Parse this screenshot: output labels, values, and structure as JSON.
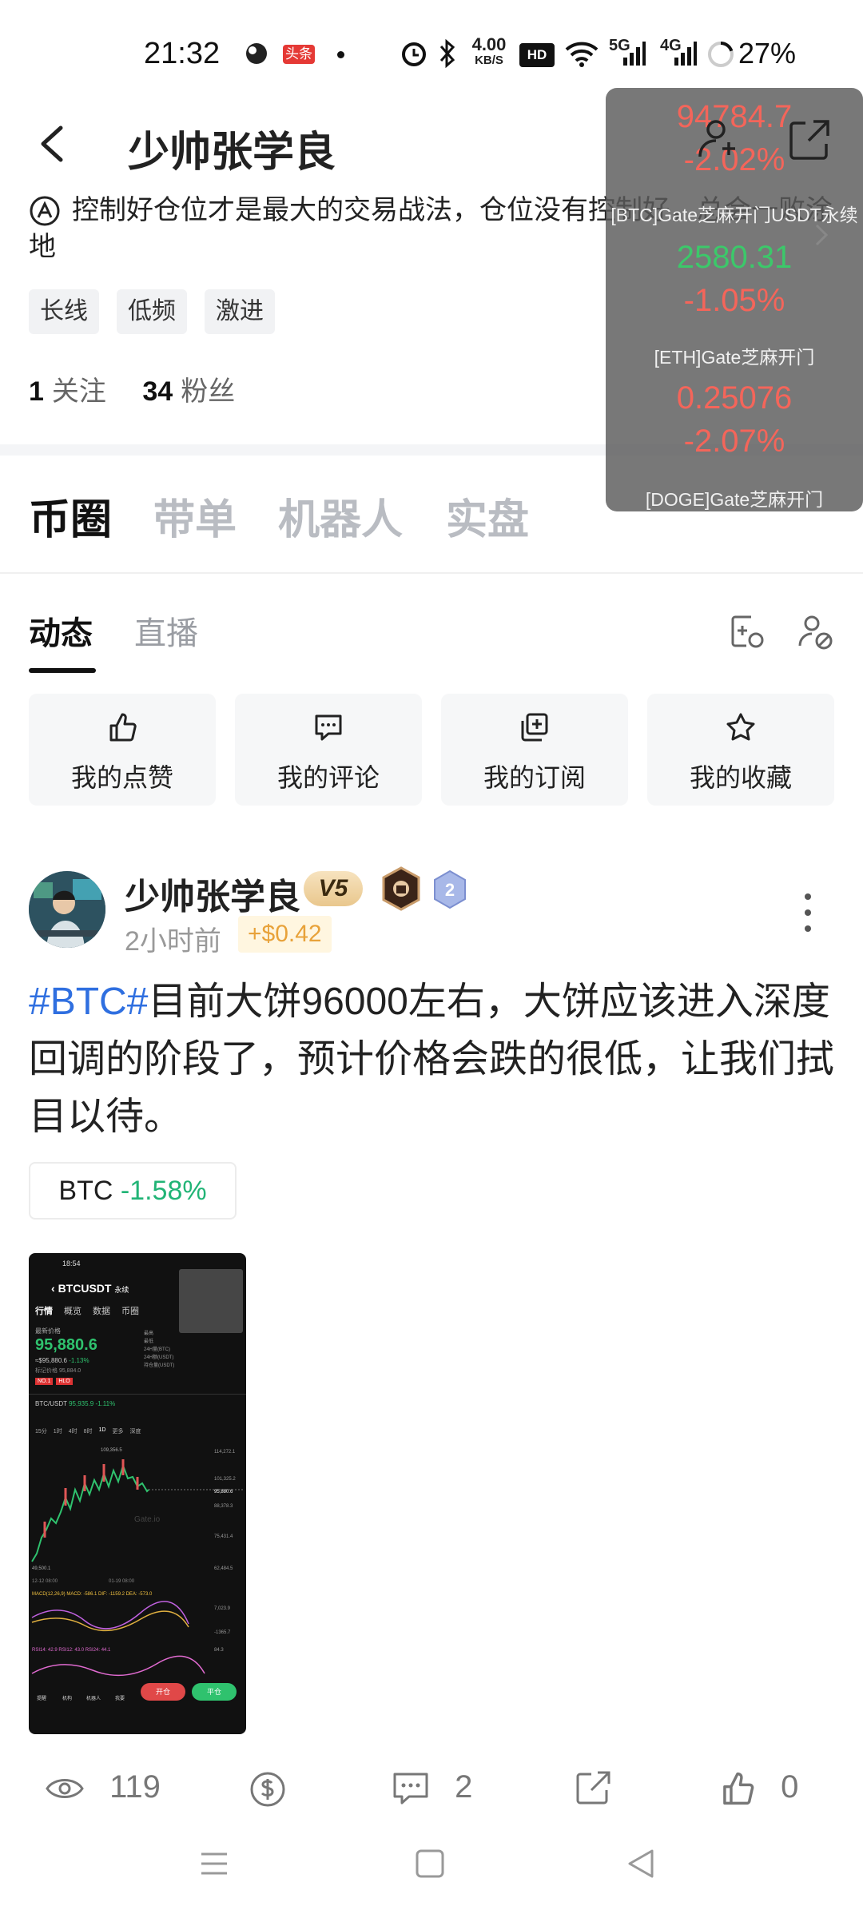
{
  "status_bar": {
    "time": "21:32",
    "app_badge": "头条",
    "network_speed_value": "4.00",
    "network_speed_unit": "KB/S",
    "hd_label": "HD",
    "net1": "5G",
    "net2": "4G",
    "battery_pct": "27%"
  },
  "profile": {
    "name": "少帅张学良",
    "bio": "控制好仓位才是最大的交易战法，仓位没有控制好，总会一败涂地",
    "tags": [
      "长线",
      "低频",
      "激进"
    ],
    "following_count": "1",
    "following_label": "关注",
    "followers_count": "34",
    "followers_label": "粉丝"
  },
  "ticker_overlay": {
    "items": [
      {
        "price": "94784.7",
        "change": "-2.02%",
        "name": "[BTC]Gate芝麻开门USDT永续",
        "color": "#f4655a"
      },
      {
        "price": "2580.31",
        "change": "-1.05%",
        "name": "[ETH]Gate芝麻开门",
        "color": "#3cc86a"
      },
      {
        "price": "0.25076",
        "change": "-2.07%",
        "name": "[DOGE]Gate芝麻开门",
        "color": "#f4655a"
      }
    ]
  },
  "main_tabs": [
    "币圈",
    "带单",
    "机器人",
    "实盘"
  ],
  "sub_tabs": [
    "动态",
    "直播"
  ],
  "actions": [
    {
      "label": "我的点赞",
      "icon": "thumbs-up-icon"
    },
    {
      "label": "我的评论",
      "icon": "comment-icon"
    },
    {
      "label": "我的订阅",
      "icon": "subscribe-icon"
    },
    {
      "label": "我的收藏",
      "icon": "star-icon"
    }
  ],
  "post": {
    "author": "少帅张学良",
    "vip": "V5",
    "level": "2",
    "time": "2小时前",
    "gain": "+$0.42",
    "hashtag": "#BTC#",
    "text": "目前大饼96000左右，大饼应该进入深度回调的阶段了，预计价格会跌的很低，让我们拭目以待。",
    "coin": "BTC",
    "coin_change": "-1.58%",
    "views": "119",
    "comments": "2",
    "likes": "0"
  },
  "thumbnail": {
    "status_time": "18:54",
    "pair": "BTCUSDT",
    "pair_suffix": "永续",
    "tabs": [
      "行情",
      "概览",
      "数据",
      "币圈"
    ],
    "latest_label": "最新价格",
    "price": "95,880.6",
    "price_sub": "≈$95,880.6",
    "change": "-1.13%",
    "mark_label": "标记价格",
    "mark_value": "95,884.0",
    "badges": [
      "NO.1",
      "HLO"
    ],
    "stats_labels": [
      "最高",
      "最低",
      "24H量(BTC)",
      "24H额(USDT)",
      "持仓量(USDT)"
    ],
    "pair2": "BTC/USDT",
    "pair2_price": "95,935.9",
    "pair2_change": "-1.11%",
    "intervals": [
      "15分",
      "1时",
      "4时",
      "8时",
      "1D",
      "更多",
      "深度"
    ],
    "y_ticks": [
      "114,272.1",
      "101,325.2",
      "95,880.6",
      "88,378.3",
      "75,431.4",
      "62,484.5",
      "7,023.9",
      "-1365.7",
      "84.3"
    ],
    "hi_label": "109,356.5",
    "lo_label": "49,500.1",
    "dates": [
      "12-12 08:00",
      "01-19 08:00"
    ],
    "macd": "MACD(12,26,9)  MACD: -586.1  DIF: -1159.2  DEA: -573.0",
    "rsi": "RSI14: 42.9  RSI12: 43.0  RSI24: 44.1",
    "watermark": "Gate.io",
    "bottom": [
      "提醒",
      "机构",
      "机器人",
      "我要"
    ],
    "buy": "开仓",
    "sell": "平仓"
  }
}
